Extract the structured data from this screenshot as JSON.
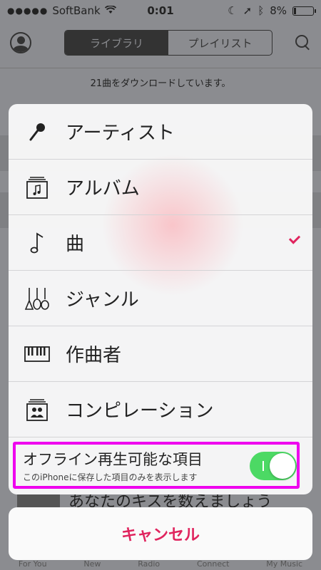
{
  "status": {
    "carrier": "SoftBank",
    "time": "0:01",
    "battery": "8%"
  },
  "nav": {
    "segments": [
      "ライブラリ",
      "プレイリスト"
    ]
  },
  "download_status": "21曲をダウンロードしています。",
  "menu": {
    "options": [
      {
        "label": "アーティスト",
        "icon": "microphone-icon"
      },
      {
        "label": "アルバム",
        "icon": "album-icon"
      },
      {
        "label": "曲",
        "icon": "music-note-icon",
        "selected": true
      },
      {
        "label": "ジャンル",
        "icon": "instruments-icon"
      },
      {
        "label": "作曲者",
        "icon": "piano-icon"
      },
      {
        "label": "コンピレーション",
        "icon": "compilation-icon"
      }
    ],
    "offline": {
      "title": "オフライン再生可能な項目",
      "subtitle": "このiPhoneに保存した項目のみを表示します",
      "toggle_on": true
    },
    "cancel_label": "キャンセル"
  },
  "background": {
    "peek_text": "あなたのキスを数えましょう",
    "tabs": [
      "For You",
      "New",
      "Radio",
      "Connect",
      "My Music"
    ]
  },
  "colors": {
    "accent": "#e0245e",
    "toggle_on": "#4cd964",
    "highlight": "#ee00ee"
  }
}
